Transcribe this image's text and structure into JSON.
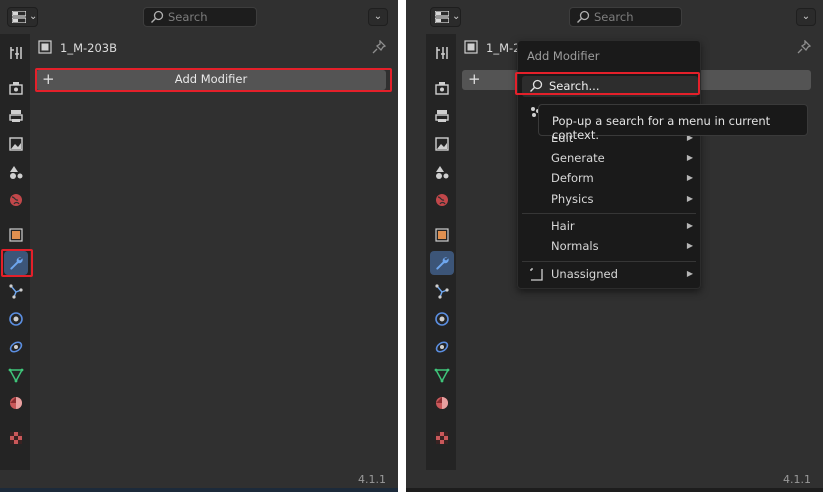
{
  "header": {
    "search_placeholder": "Search"
  },
  "object": {
    "name": "1_M-203B"
  },
  "modifier_panel": {
    "add_modifier_label": "Add Modifier"
  },
  "tabs": [
    "tool-icon",
    "render-icon",
    "output-icon",
    "view-layer-icon",
    "scene-icon",
    "world-icon",
    "object-icon",
    "modifier-wrench-icon",
    "particles-icon",
    "physics-icon",
    "constraints-icon",
    "data-icon",
    "material-icon",
    "texture-icon"
  ],
  "menu": {
    "title": "Add Modifier",
    "search_label": "Search...",
    "items": [
      "Edit",
      "Generate",
      "Deform",
      "Physics",
      "Hair",
      "Normals",
      "Unassigned"
    ]
  },
  "tooltip": {
    "text": "Pop-up a search for a menu in current context."
  },
  "version": "4.1.1",
  "colors": {
    "highlight": "#e4202a",
    "active_tab": "#3c5578",
    "panel_bg": "#303030"
  }
}
